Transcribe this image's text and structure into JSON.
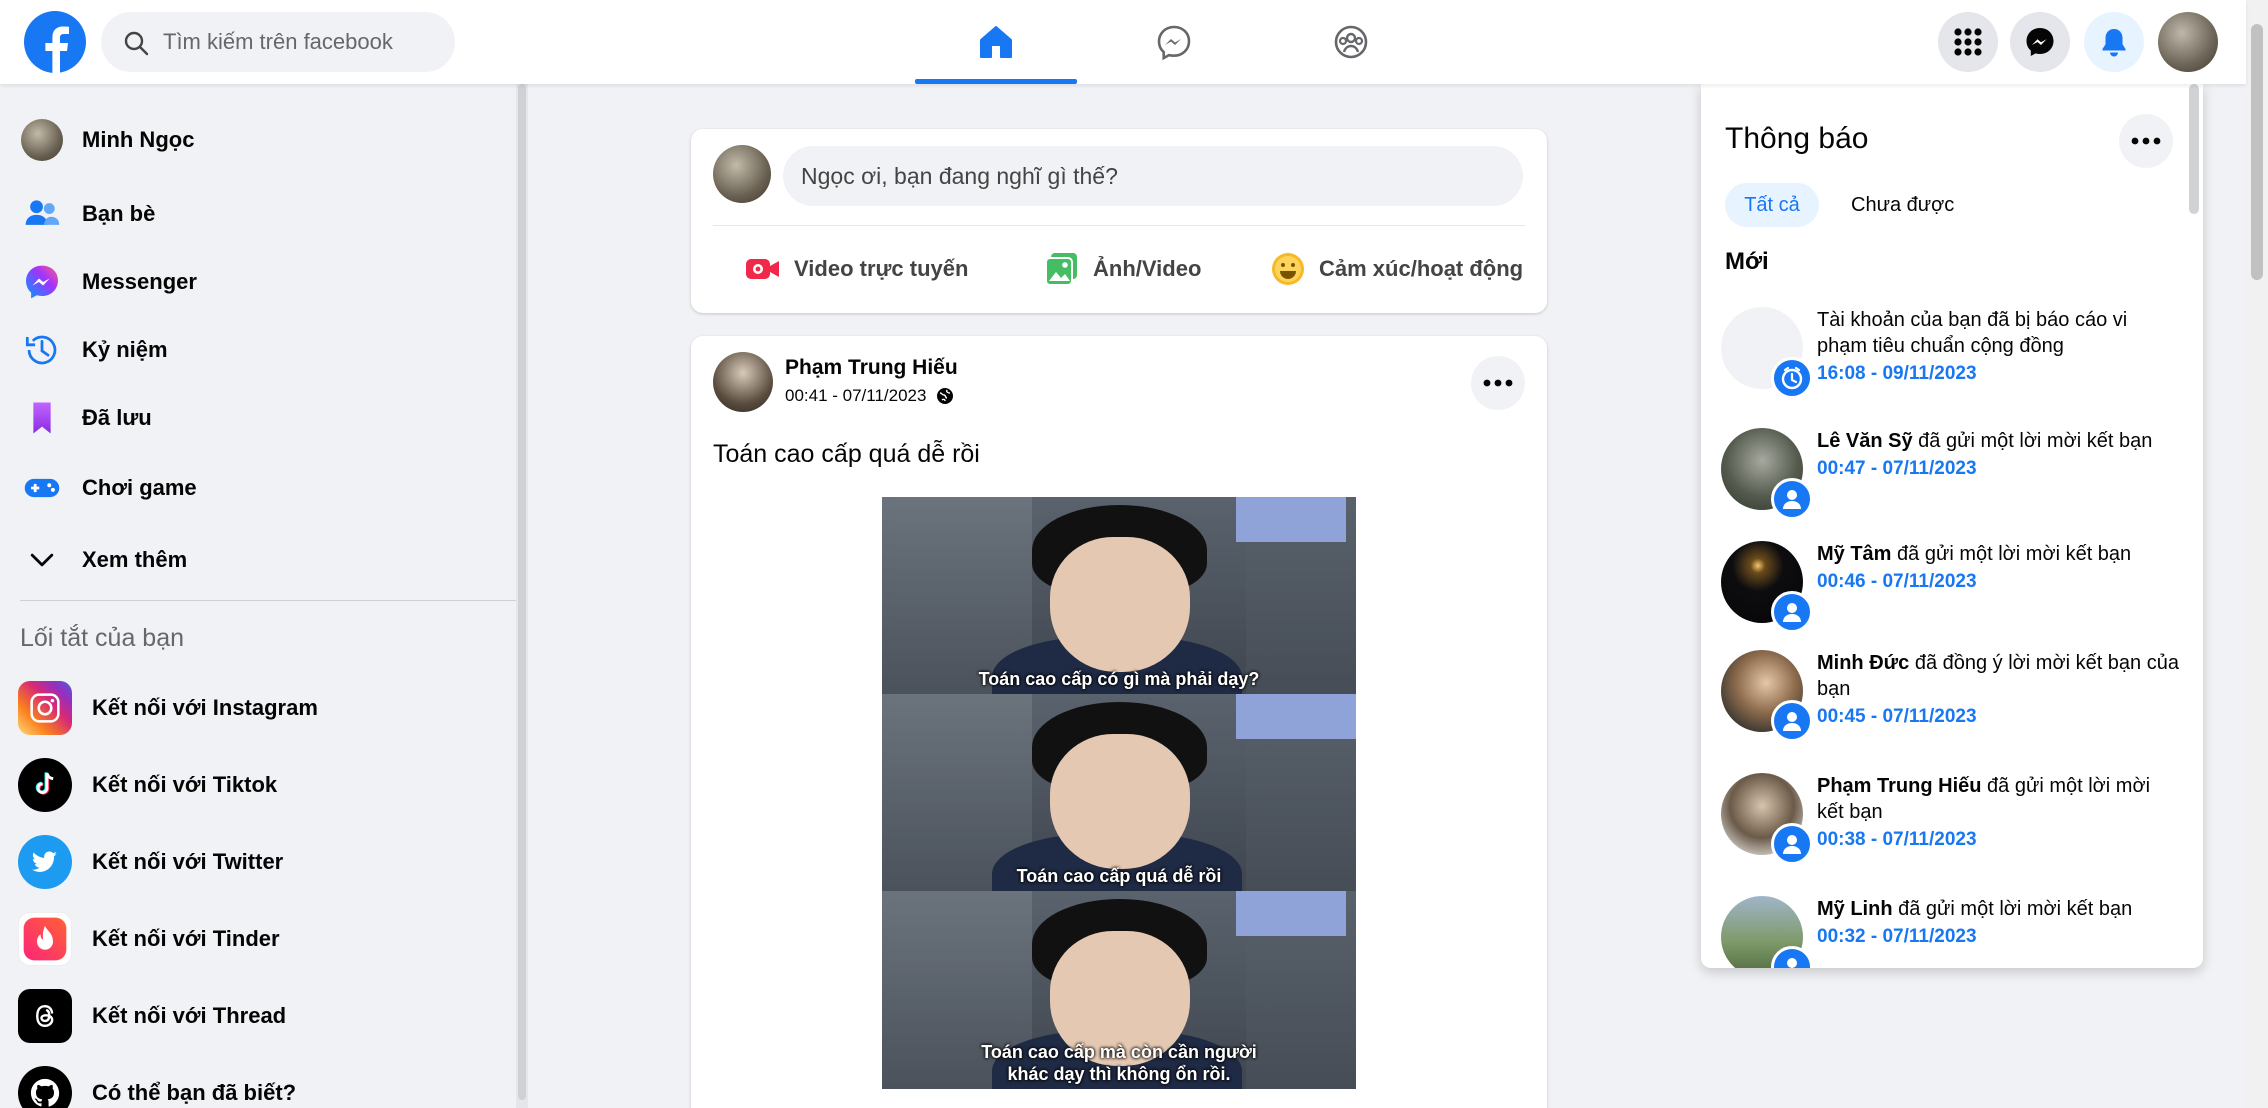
{
  "header": {
    "search_placeholder": "Tìm kiếm trên facebook",
    "brand_color": "#1877f2",
    "active_tab": "home",
    "tabs": [
      "home-icon",
      "messenger-icon",
      "groups-icon"
    ],
    "right_icons": [
      "menu-grid-icon",
      "messenger-icon",
      "bell-icon",
      "avatar"
    ]
  },
  "sidebar": {
    "items": [
      {
        "label": "Minh Ngọc",
        "icon": "avatar"
      },
      {
        "label": "Bạn bè",
        "icon": "friends-icon"
      },
      {
        "label": "Messenger",
        "icon": "messenger-icon"
      },
      {
        "label": "Kỷ niệm",
        "icon": "memories-icon"
      },
      {
        "label": "Đã lưu",
        "icon": "saved-icon"
      },
      {
        "label": "Chơi game",
        "icon": "gaming-icon"
      },
      {
        "label": "Xem thêm",
        "icon": "chevron-down-icon"
      }
    ],
    "shortcuts_title": "Lối tắt của bạn",
    "shortcuts": [
      {
        "label": "Kết nối với Instagram",
        "icon": "instagram-icon"
      },
      {
        "label": "Kết nối với Tiktok",
        "icon": "tiktok-icon"
      },
      {
        "label": "Kết nối với Twitter",
        "icon": "twitter-icon"
      },
      {
        "label": "Kết nối với Tinder",
        "icon": "tinder-icon"
      },
      {
        "label": "Kết nối với Thread",
        "icon": "threads-icon"
      },
      {
        "label": "Có thể bạn đã biết?",
        "icon": "github-icon"
      }
    ]
  },
  "composer": {
    "placeholder": "Ngọc ơi, bạn đang nghĩ gì thế?",
    "actions": [
      {
        "label": "Video trực tuyến",
        "icon": "live-video-icon",
        "color": "#f02849"
      },
      {
        "label": "Ảnh/Video",
        "icon": "photo-icon",
        "color": "#45bd62"
      },
      {
        "label": "Cảm xúc/hoạt động",
        "icon": "feeling-icon",
        "color": "#f7b928"
      }
    ]
  },
  "post": {
    "author": "Phạm Trung Hiếu",
    "timestamp": "00:41 - 07/11/2023",
    "privacy_icon": "globe-icon",
    "text": "Toán cao cấp quá dễ rồi",
    "image_captions": [
      "Toán cao cấp có gì mà phải dạy?",
      "Toán cao cấp quá dễ rồi",
      "Toán cao cấp mà còn cần người khác dạy thì không ổn rồi."
    ]
  },
  "notifications": {
    "title": "Thông báo",
    "tab_all": "Tất cả",
    "tab_unread": "Chưa được",
    "section_new": "Mới",
    "items": [
      {
        "name": "",
        "text": "Tài khoản của bạn đã bị báo cáo vi phạm tiêu chuẩn cộng đồng",
        "time": "16:08 - 09/11/2023",
        "badge": "clock-icon"
      },
      {
        "name": "Lê Văn Sỹ",
        "text": " đã gửi một lời mời kết bạn",
        "time": "00:47 - 07/11/2023",
        "badge": "person-icon"
      },
      {
        "name": "Mỹ Tâm",
        "text": " đã gửi một lời mời kết bạn",
        "time": "00:46 - 07/11/2023",
        "badge": "person-icon"
      },
      {
        "name": "Minh Đức",
        "text": " đã đồng ý lời mời kết bạn của bạn",
        "time": "00:45 - 07/11/2023",
        "badge": "person-icon"
      },
      {
        "name": "Phạm Trung Hiếu",
        "text": " đã gửi một lời mời kết bạn",
        "time": "00:38 - 07/11/2023",
        "badge": "person-icon"
      },
      {
        "name": "Mỹ Linh",
        "text": " đã gửi một lời mời kết bạn",
        "time": "00:32 - 07/11/2023",
        "badge": "person-icon"
      }
    ]
  }
}
